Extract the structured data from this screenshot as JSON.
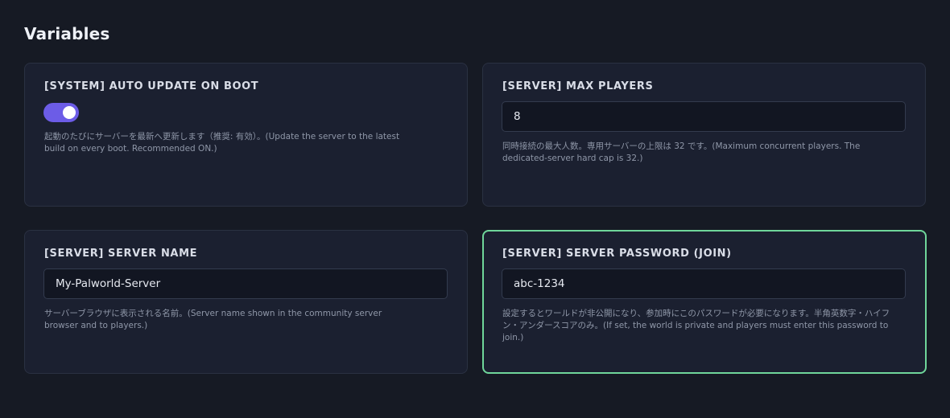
{
  "page": {
    "title": "Variables"
  },
  "colors": {
    "background": "#161a24",
    "card": "#1b2030",
    "toggle_on": "#6c5ce7",
    "focus_border": "#6fd69a"
  },
  "variables": [
    {
      "label": "[SYSTEM] AUTO UPDATE ON BOOT",
      "type": "toggle",
      "enabled": true,
      "description": "起動のたびにサーバーを最新へ更新します（推奨: 有効）。(Update the server to the latest build on every boot. Recommended ON.)"
    },
    {
      "label": "[SERVER] MAX PLAYERS",
      "type": "text",
      "value": "8",
      "description": "同時接続の最大人数。専用サーバーの上限は 32 です。(Maximum concurrent players. The dedicated-server hard cap is 32.)"
    },
    {
      "label": "[SERVER] SERVER NAME",
      "type": "text",
      "value": "My-Palworld-Server",
      "description": "サーバーブラウザに表示される名前。(Server name shown in the community server browser and to players.)"
    },
    {
      "label": "[SERVER] SERVER PASSWORD (JOIN)",
      "type": "text",
      "value": "abc-1234",
      "focused": true,
      "description": "設定するとワールドが非公開になり、参加時にこのパスワードが必要になります。半角英数字・ハイフン・アンダースコアのみ。(If set, the world is private and players must enter this password to join.)"
    }
  ]
}
